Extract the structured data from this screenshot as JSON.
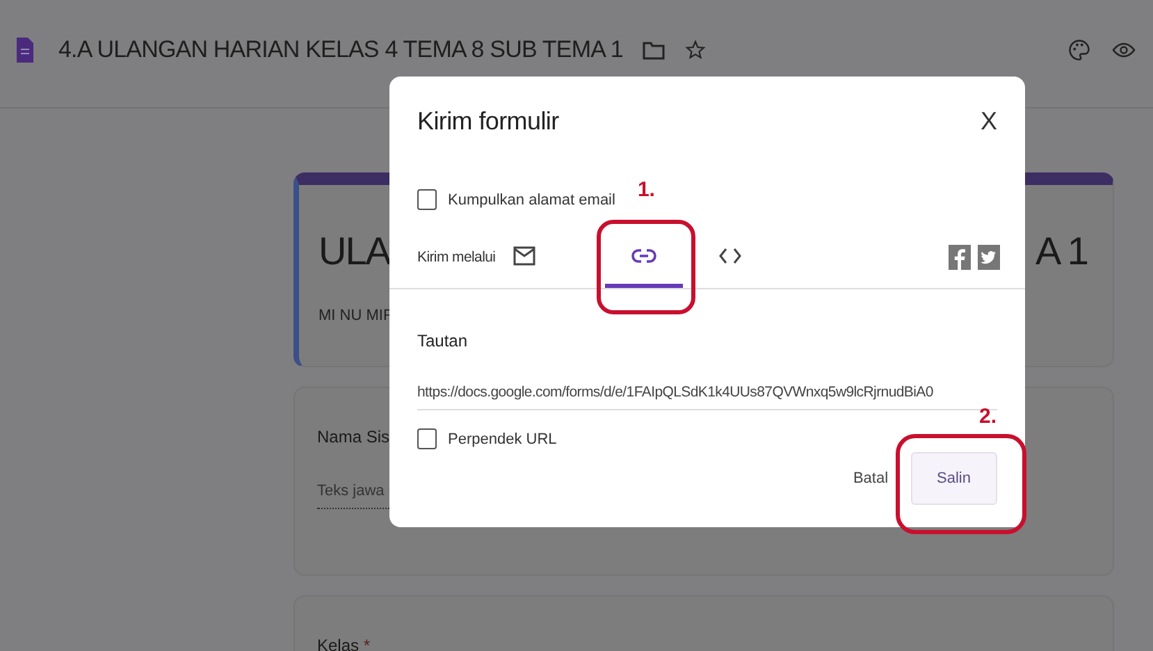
{
  "header": {
    "title": "4.A ULANGAN HARIAN KELAS 4 TEMA 8 SUB TEMA 1"
  },
  "form_cards": [
    {
      "kind": "title",
      "left_text": "ULA",
      "right_text": "A 1",
      "subtitle": "MI NU MIF"
    },
    {
      "kind": "question",
      "label": "Nama Sis",
      "placeholder": "Teks jawa"
    },
    {
      "kind": "question",
      "label": "Kelas",
      "required_mark": "*"
    }
  ],
  "dialog": {
    "title": "Kirim formulir",
    "close": "X",
    "collect_email": {
      "label": "Kumpulkan alamat email",
      "checked": false
    },
    "send_via_label": "Kirim melalui",
    "tabs": [
      {
        "kind": "email",
        "selected": false
      },
      {
        "kind": "link",
        "selected": true
      },
      {
        "kind": "embed",
        "selected": false
      }
    ],
    "link_heading": "Tautan",
    "link_value": "https://docs.google.com/forms/d/e/1FAIpQLSdK1k4UUs87QVWnxq5w9lcRjrnudBiA0",
    "shorten_url": {
      "label": "Perpendek URL",
      "checked": false
    },
    "buttons": [
      {
        "label": "Batal",
        "kind": "text"
      },
      {
        "label": "Salin",
        "kind": "filled"
      }
    ]
  },
  "annotations": [
    {
      "label": "1."
    },
    {
      "label": "2."
    }
  ]
}
